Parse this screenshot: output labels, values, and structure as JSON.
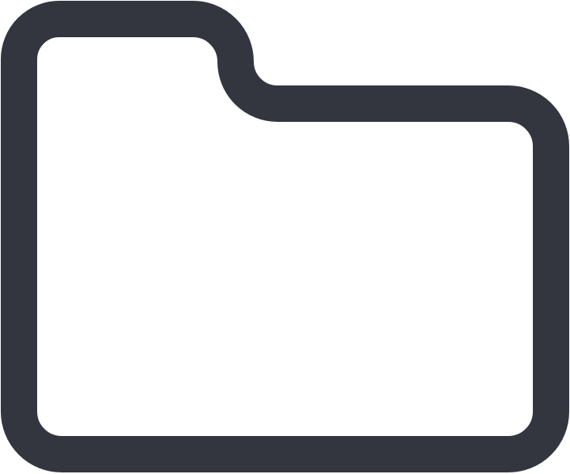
{
  "icon": {
    "name": "folder-icon",
    "style": "outline",
    "stroke_color": "#33363f",
    "fill_color": "#ffffff",
    "background_color": "#ffffff"
  }
}
